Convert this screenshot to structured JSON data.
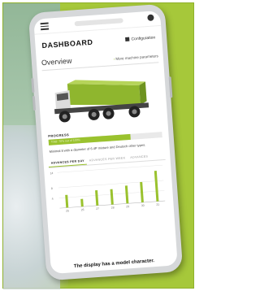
{
  "header": {
    "title": "DASHBOARD",
    "configuration_label": "Configuration"
  },
  "overview": {
    "title": "Overview",
    "more_link": "More machine parameters"
  },
  "progress": {
    "label": "PROGRESS",
    "bar_text": "Total: 70% out of 100%",
    "fraction": 0.72
  },
  "description": "Minimal 8 with a diameter of 6.4P mixture and Deutsch other types.",
  "tabs": [
    {
      "label": "ADVANCES PER DAY",
      "active": true
    },
    {
      "label": "ADVANCES PER WEEK",
      "active": false
    },
    {
      "label": "ADVANCES",
      "active": false
    }
  ],
  "chart_data": {
    "type": "bar",
    "categories": [
      "25",
      "26",
      "27",
      "28",
      "29",
      "30",
      "31"
    ],
    "values": [
      5,
      3,
      6,
      6,
      7,
      8,
      12
    ],
    "y_ticks": [
      "14",
      "8",
      "4"
    ],
    "ylim": [
      0,
      14
    ],
    "bar_color": "#9ac22e"
  },
  "caption": "The display has a model character.",
  "colors": {
    "accent": "#9ac22e",
    "frame": "#a6c83a"
  }
}
